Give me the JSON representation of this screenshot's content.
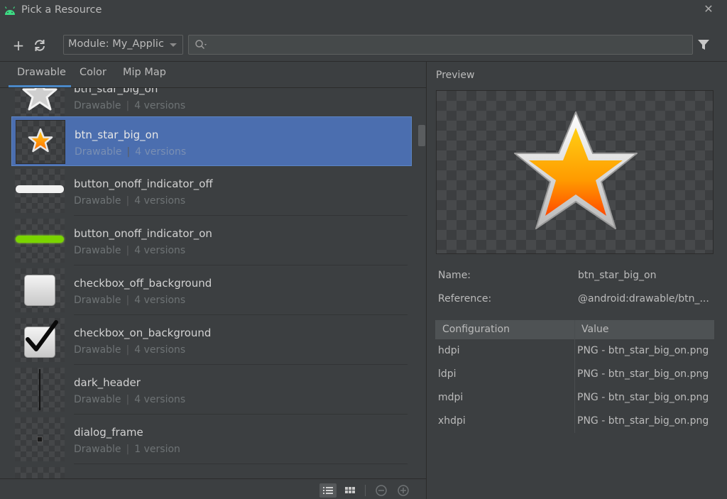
{
  "window": {
    "title": "Pick a Resource",
    "close_glyph": "✕",
    "app_icon": "android-icon"
  },
  "toolbar": {
    "add_glyph": "+",
    "refresh_icon": "refresh-icon",
    "module_label": "Module: My_Applic",
    "search_value": "",
    "filter_icon": "filter-icon"
  },
  "tabs": [
    {
      "label": "Drawable",
      "active": true
    },
    {
      "label": "Color",
      "active": false
    },
    {
      "label": "Mip Map",
      "active": false
    }
  ],
  "list": {
    "separator": "|",
    "items": [
      {
        "name": "btn_star_big_on",
        "type": "Drawable",
        "versions": "4 versions",
        "thumb": "star-gray"
      },
      {
        "name": "btn_star_big_on",
        "type": "Drawable",
        "versions": "4 versions",
        "thumb": "star-gold",
        "selected": true
      },
      {
        "name": "button_onoff_indicator_off",
        "type": "Drawable",
        "versions": "4 versions",
        "thumb": "bar-white"
      },
      {
        "name": "button_onoff_indicator_on",
        "type": "Drawable",
        "versions": "4 versions",
        "thumb": "bar-green"
      },
      {
        "name": "checkbox_off_background",
        "type": "Drawable",
        "versions": "4 versions",
        "thumb": "checkbox-empty"
      },
      {
        "name": "checkbox_on_background",
        "type": "Drawable",
        "versions": "4 versions",
        "thumb": "checkbox-checked"
      },
      {
        "name": "dark_header",
        "type": "Drawable",
        "versions": "4 versions",
        "thumb": "vertical-line"
      },
      {
        "name": "dialog_frame",
        "type": "Drawable",
        "versions": "1 version",
        "thumb": "dot"
      }
    ]
  },
  "preview": {
    "label": "Preview",
    "name_key": "Name:",
    "name_value": "btn_star_big_on",
    "ref_key": "Reference:",
    "ref_value": "@android:drawable/btn_..."
  },
  "config_table": {
    "headers": [
      "Configuration",
      "Value"
    ],
    "rows": [
      [
        "hdpi",
        "PNG - btn_star_big_on.png"
      ],
      [
        "ldpi",
        "PNG - btn_star_big_on.png"
      ],
      [
        "mdpi",
        "PNG - btn_star_big_on.png"
      ],
      [
        "xhdpi",
        "PNG - btn_star_big_on.png"
      ]
    ]
  },
  "colors": {
    "background": "#3c3f41",
    "selection": "#4b6eaf",
    "tab_underline": "#4a88c7",
    "android_green": "#3ddc84"
  }
}
